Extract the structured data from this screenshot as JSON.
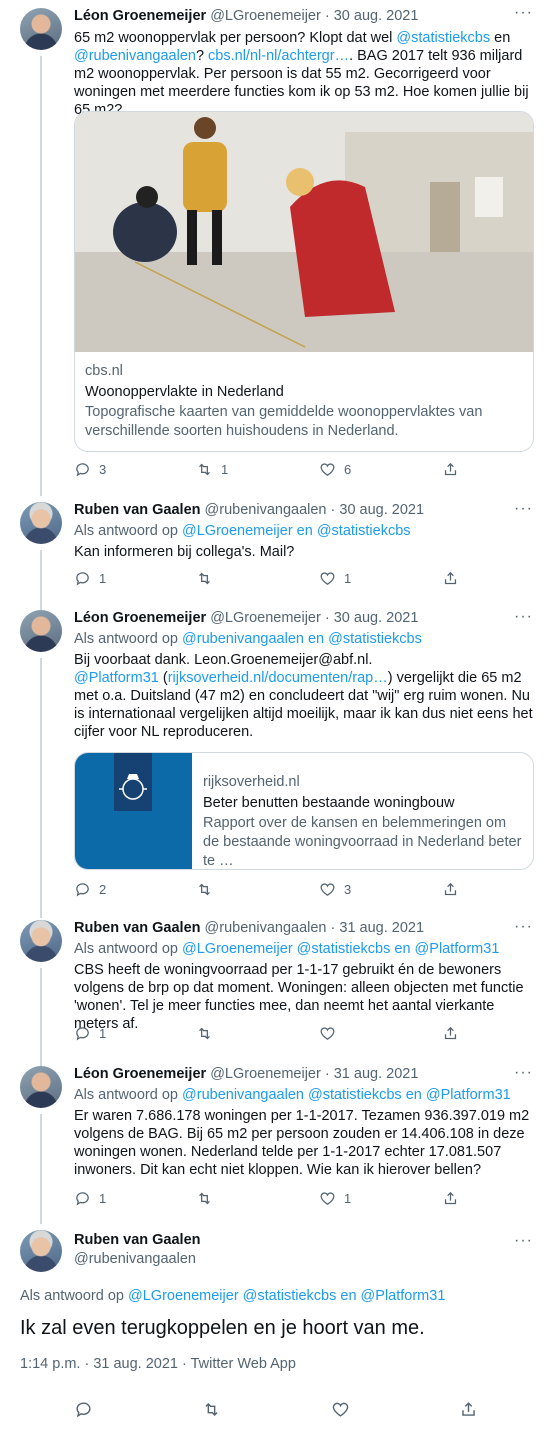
{
  "tweets": [
    {
      "name": "Léon Groenemeijer",
      "handle": "@LGroenemeijer",
      "date": "30 aug. 2021",
      "text_1": "65 m2 woonoppervlak per persoon? Klopt dat wel ",
      "mention_1": "@statistiekcbs",
      "text_2": " en",
      "mention_2": "@rubenivangaalen",
      "text_3": "? ",
      "link": "cbs.nl/nl-nl/achtergr…",
      "text_4": ". BAG 2017 telt 936 miljard m2 woonoppervlak. Per persoon is dat 55 m2. Gecorrigeerd voor woningen met meerdere functies kom ik op 53 m2. Hoe komen jullie bij 65 m2?",
      "card": {
        "domain": "cbs.nl",
        "title": "Woonoppervlakte in Nederland",
        "desc": "Topografische kaarten van gemiddelde woonoppervlaktes van verschillende soorten huishoudens in Nederland."
      },
      "replies": "3",
      "retweets": "1",
      "likes": "6"
    },
    {
      "name": "Ruben van Gaalen",
      "handle": "@rubenivangaalen",
      "date": "30 aug. 2021",
      "reply_prefix": "Als antwoord op ",
      "reply_to": "@LGroenemeijer en @statistiekcbs",
      "text": "Kan informeren bij collega's. Mail?",
      "replies": "1",
      "retweets": "",
      "likes": "1"
    },
    {
      "name": "Léon Groenemeijer",
      "handle": "@LGroenemeijer",
      "date": "30 aug. 2021",
      "reply_prefix": "Als antwoord op ",
      "reply_to": "@rubenivangaalen en @statistiekcbs",
      "text_1": "Bij voorbaat dank. Leon.Groenemeijer@abf.nl.",
      "mention_1": "@Platform31",
      "text_2": " (",
      "link": "rijksoverheid.nl/documenten/rap…",
      "text_3": ") vergelijkt die 65 m2 met o.a. Duitsland (47 m2) en concludeert dat \"wij\" erg ruim wonen. Nu is internationaal vergelijken altijd moeilijk, maar ik kan dus niet eens het cijfer voor NL reproduceren.",
      "card": {
        "domain": "rijksoverheid.nl",
        "title": "Beter benutten bestaande woningbouw",
        "desc": "Rapport over de kansen en belemmeringen om de bestaande woningvoorraad in Nederland beter te …"
      },
      "replies": "2",
      "retweets": "",
      "likes": "3"
    },
    {
      "name": "Ruben van Gaalen",
      "handle": "@rubenivangaalen",
      "date": "31 aug. 2021",
      "reply_prefix": "Als antwoord op ",
      "reply_to": "@LGroenemeijer @statistiekcbs en @Platform31",
      "text": "CBS heeft de woningvoorraad per 1-1-17 gebruikt én de bewoners volgens de brp op dat moment. Woningen: alleen objecten met functie 'wonen'. Tel je meer functies mee, dan neemt het aantal vierkante meters af.",
      "replies": "1",
      "retweets": "",
      "likes": ""
    },
    {
      "name": "Léon Groenemeijer",
      "handle": "@LGroenemeijer",
      "date": "31 aug. 2021",
      "reply_prefix": "Als antwoord op ",
      "reply_to": "@rubenivangaalen @statistiekcbs en @Platform31",
      "text": "Er waren 7.686.178 woningen per 1-1-2017. Tezamen 936.397.019 m2 volgens de BAG. Bij 65 m2 per persoon zouden er 14.406.108 in deze woningen wonen. Nederland telde per 1-1-2017 echter 17.081.507 inwoners. Dit kan echt niet kloppen. Wie kan ik hierover bellen?",
      "replies": "1",
      "retweets": "",
      "likes": "1"
    }
  ],
  "main_tweet": {
    "name": "Ruben van Gaalen",
    "handle": "@rubenivangaalen",
    "reply_prefix": "Als antwoord op ",
    "reply_to": "@LGroenemeijer @statistiekcbs en @Platform31",
    "text": "Ik zal even terugkoppelen en je hoort van me.",
    "meta": "1:14 p.m. · 31 aug. 2021 · Twitter Web App"
  },
  "more_label": "···",
  "separator": " · ",
  "colors": {
    "link": "#1d9bf0",
    "muted": "#536471",
    "text": "#0f1419"
  }
}
